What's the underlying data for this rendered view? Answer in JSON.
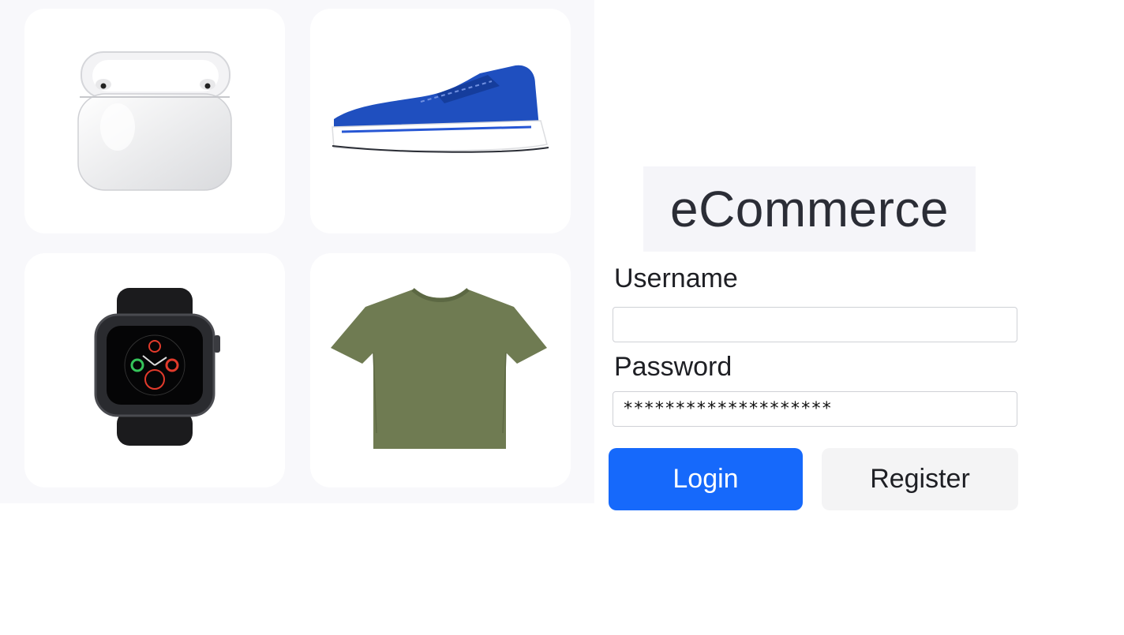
{
  "products": [
    {
      "name": "airpods",
      "icon": "airpods-icon"
    },
    {
      "name": "sneaker",
      "icon": "sneaker-icon"
    },
    {
      "name": "smartwatch",
      "icon": "smartwatch-icon"
    },
    {
      "name": "tshirt",
      "icon": "tshirt-icon"
    }
  ],
  "brand": {
    "title": "eCommerce"
  },
  "form": {
    "username_label": "Username",
    "username_value": "",
    "password_label": "Password",
    "password_value": "********************"
  },
  "buttons": {
    "login_label": "Login",
    "register_label": "Register"
  },
  "colors": {
    "primary": "#1669fb",
    "secondary_bg": "#f4f4f5",
    "gallery_bg": "#f8f8fb"
  }
}
